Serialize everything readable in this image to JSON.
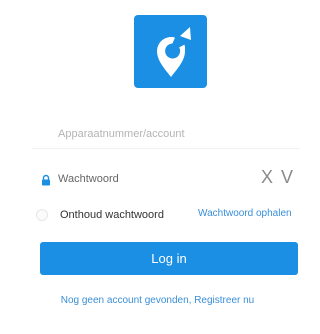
{
  "colors": {
    "brand": "#1a8fe3",
    "link": "#3a8fd8",
    "background": "#ffffff"
  },
  "logo": {
    "icon": "location-pin-icon"
  },
  "account": {
    "placeholder": "Apparaatnummer/account",
    "value": ""
  },
  "password": {
    "icon": "lock-icon",
    "placeholder": "Wachtwoord",
    "value": "",
    "clear_label": "X",
    "show_label": "V"
  },
  "remember": {
    "label": "Onthoud wachtwoord",
    "checked": false
  },
  "forgot": {
    "label": "Wachtwoord ophalen"
  },
  "login": {
    "label": "Log in"
  },
  "register": {
    "prompt": "Nog geen account gevonden,",
    "link": "Registreer nu"
  }
}
